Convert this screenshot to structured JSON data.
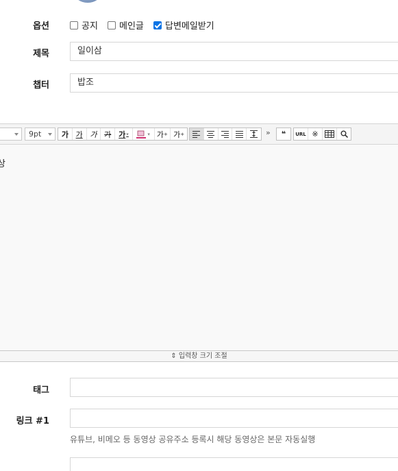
{
  "options": {
    "label": "옵션",
    "items": [
      {
        "label": "공지",
        "checked": false
      },
      {
        "label": "메인글",
        "checked": false
      },
      {
        "label": "답변메일받기",
        "checked": true
      }
    ]
  },
  "title_field": {
    "label": "제목",
    "value": "일이삼"
  },
  "chapter_field": {
    "label": "챕터",
    "value": "밥조"
  },
  "toolbar": {
    "font_size": "9pt",
    "format_buttons": [
      "가",
      "가",
      "가",
      "가",
      "가"
    ],
    "superscript": "가",
    "subscript": "가",
    "more": "»",
    "quote": "❝",
    "url": "URL",
    "special_char": "※",
    "table": "▦",
    "search": "🔍"
  },
  "editor": {
    "content": "상"
  },
  "resize_bar": {
    "label": "⇕ 입력창 크기 조절"
  },
  "tag_field": {
    "label": "태그",
    "value": ""
  },
  "link_field": {
    "label": "링크 #1",
    "value": "",
    "hint": "유튜브, 비메오 등 동영상 공유주소 등록시 해당 동영상은 본문 자동실행"
  }
}
